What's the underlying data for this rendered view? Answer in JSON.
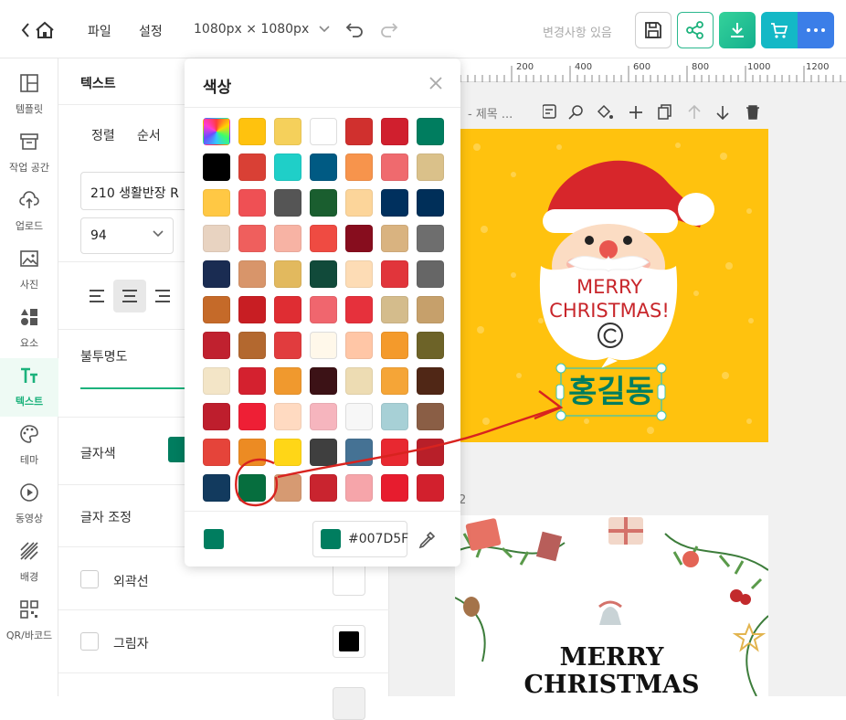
{
  "topbar": {
    "menus": [
      "파일",
      "설정"
    ],
    "size_label": "1080px × 1080px",
    "status": "변경사항 있음",
    "buttons": [
      "save-icon",
      "share-icon",
      "download-icon",
      "cart-icon",
      "more-icon"
    ]
  },
  "nav": {
    "items": [
      {
        "label": "템플릿",
        "icon": "template-icon"
      },
      {
        "label": "작업 공간",
        "icon": "workspace-icon"
      },
      {
        "label": "업로드",
        "icon": "upload-icon"
      },
      {
        "label": "사진",
        "icon": "photo-icon"
      },
      {
        "label": "요소",
        "icon": "elements-icon"
      },
      {
        "label": "텍스트",
        "icon": "text-icon",
        "active": true
      },
      {
        "label": "테마",
        "icon": "palette-icon"
      },
      {
        "label": "동영상",
        "icon": "video-icon"
      },
      {
        "label": "배경",
        "icon": "background-icon"
      },
      {
        "label": "QR/바코드",
        "icon": "qr-icon"
      }
    ]
  },
  "panel": {
    "title": "텍스트",
    "tabs": [
      "정렬",
      "순서"
    ],
    "font_name": "210 생활반장 R",
    "font_size": "94",
    "opacity_label": "불투명도",
    "font_color_label": "글자색",
    "font_color": "#007D5F",
    "adjust_label": "글자 조정",
    "outline_label": "외곽선",
    "shadow_label": "그림자",
    "outline_color": "#FFFFFF",
    "shadow_color": "#000000"
  },
  "popup": {
    "title": "색상",
    "hex_value": "#007D5F",
    "current_color": "#007D5F",
    "colors": [
      [
        "gradient",
        "#FFC20E",
        "#F5D05B",
        "#FFFFFF",
        "#D0302E",
        "#D01F2E",
        "#007D5F"
      ],
      [
        "#000000",
        "#D94035",
        "#1FCFC8",
        "#005A83",
        "#F7944C",
        "#EF6A6E",
        "#DAC18A"
      ],
      [
        "#FFC844",
        "#EF5054",
        "#555555",
        "#1A5E2F",
        "#FCD59A",
        "#00305E",
        "#002F59"
      ],
      [
        "#E8D3C1",
        "#EF5F5D",
        "#F7B3A4",
        "#EF4B42",
        "#870D1E",
        "#D9B380",
        "#6E6E6E"
      ],
      [
        "#1A2C52",
        "#D8956A",
        "#E2B95E",
        "#114A3A",
        "#FDDCB5",
        "#E1353B",
        "#666666"
      ],
      [
        "#C56A29",
        "#C81E23",
        "#DF2D33",
        "#F0666E",
        "#E6313C",
        "#D4BC8C",
        "#C6A06B"
      ],
      [
        "#C0212F",
        "#B3682F",
        "#E13C3E",
        "#FFF8EA",
        "#FFC6A6",
        "#F49A2B",
        "#6D6328"
      ],
      [
        "#F3E5C7",
        "#D4212F",
        "#F0992E",
        "#3C1216",
        "#EDDCB3",
        "#F5A537",
        "#502716"
      ],
      [
        "#BE1E2D",
        "#EE1F35",
        "#FFDAC1",
        "#F6B5BE",
        "#F7F7F7",
        "#A7D0D6",
        "#8A5E45"
      ],
      [
        "#E5443A",
        "#EC8B23",
        "#FFD617",
        "#3F3F3F",
        "#457294",
        "#E82830",
        "#B81F29"
      ],
      [
        "#123A5E",
        "#066E3E",
        "#D69A72",
        "#C9242F",
        "#F6A5AA",
        "#E71C2E",
        "#D2202D"
      ]
    ]
  },
  "canvas": {
    "ruler_labels": [
      "200",
      "400",
      "600",
      "800",
      "1000",
      "1200"
    ],
    "page_title": "- 제목 ...",
    "card1": {
      "greeting_line1": "MERRY",
      "greeting_line2": "CHRISTMAS!",
      "name_text": "홍길동",
      "name_color": "#007D5F",
      "bg_color": "#FFC20E"
    },
    "card2": {
      "title_line1": "MERRY",
      "title_line2": "CHRISTMAS"
    }
  }
}
